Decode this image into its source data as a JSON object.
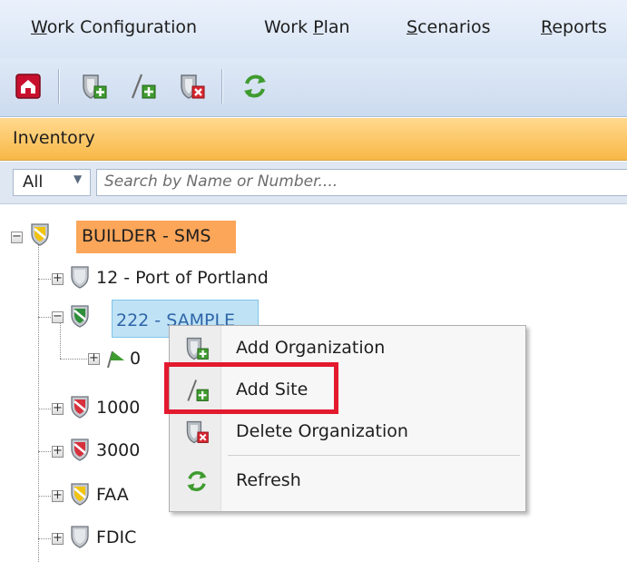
{
  "menubar": {
    "items": [
      {
        "prefix": "",
        "ul": "W",
        "rest": "ork Configuration"
      },
      {
        "prefix": "Work ",
        "ul": "P",
        "rest": "lan"
      },
      {
        "prefix": "",
        "ul": "S",
        "rest": "cenarios"
      },
      {
        "prefix": "",
        "ul": "R",
        "rest": "eports"
      }
    ]
  },
  "toolbar": {
    "icons": [
      "home-icon",
      "add-organization-icon",
      "add-site-icon",
      "delete-organization-icon",
      "refresh-icon"
    ]
  },
  "inventory": {
    "title": "Inventory"
  },
  "filter": {
    "selected": "All",
    "search_placeholder": "Search by Name or Number...."
  },
  "tree": {
    "root": "BUILDER - SMS",
    "nodes": [
      {
        "label": "12 - Port of Portland"
      },
      {
        "label": "222 - SAMPLE"
      },
      {
        "label": "0"
      },
      {
        "label": "1000"
      },
      {
        "label": "3000"
      },
      {
        "label": "FAA"
      },
      {
        "label": "FDIC"
      }
    ]
  },
  "context_menu": {
    "items": [
      {
        "label": "Add Organization"
      },
      {
        "label": "Add Site"
      },
      {
        "label": "Delete Organization"
      },
      {
        "label": "Refresh"
      }
    ]
  },
  "colors": {
    "accent": "#f8b847",
    "root_highlight": "#fca65a",
    "selected": "#bfe3f5",
    "callout": "#e3192d"
  }
}
